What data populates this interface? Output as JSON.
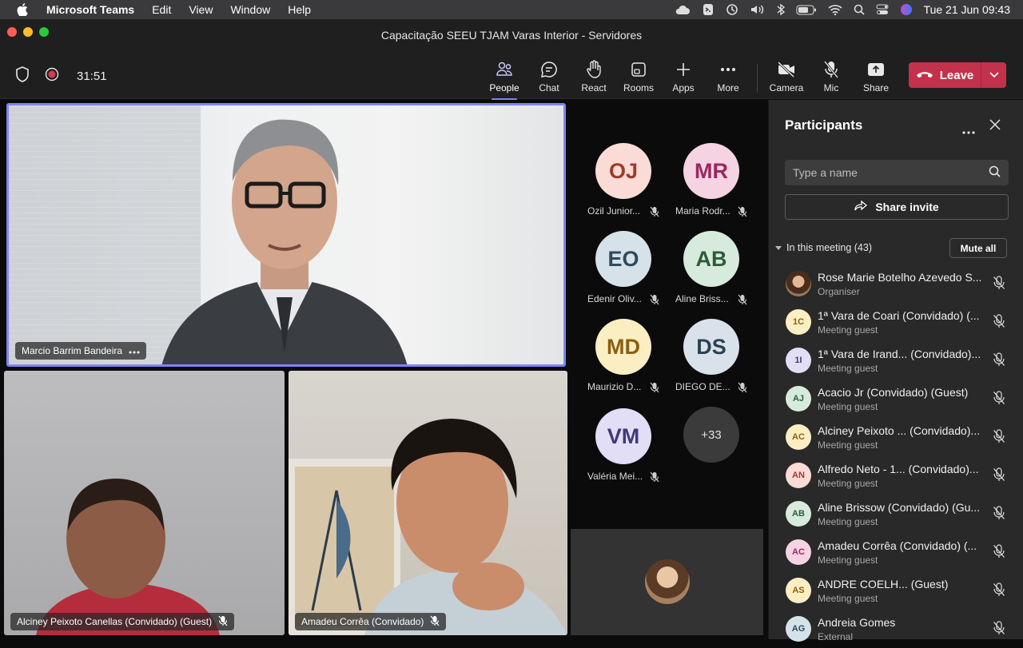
{
  "menubar": {
    "app": "Microsoft Teams",
    "items": [
      "Edit",
      "View",
      "Window",
      "Help"
    ],
    "clock": "Tue 21 Jun  09:43"
  },
  "window": {
    "title": "Capacitação SEEU TJAM Varas Interior - Servidores"
  },
  "toolbar": {
    "timer": "31:51",
    "buttons": [
      {
        "label": "People",
        "icon": "people-icon"
      },
      {
        "label": "Chat",
        "icon": "chat-icon"
      },
      {
        "label": "React",
        "icon": "hand-icon"
      },
      {
        "label": "Rooms",
        "icon": "rooms-icon"
      },
      {
        "label": "Apps",
        "icon": "plus-icon"
      },
      {
        "label": "More",
        "icon": "more-icon"
      },
      {
        "label": "Camera",
        "icon": "camera-off-icon"
      },
      {
        "label": "Mic",
        "icon": "mic-off-icon"
      },
      {
        "label": "Share",
        "icon": "share-icon"
      }
    ],
    "leave_label": "Leave"
  },
  "stage": {
    "main_video": "Marcio Barrim Bandeira",
    "bottom_left": "Alciney Peixoto Canellas (Convidado) (Guest)",
    "bottom_right": "Amadeu Corrêa (Convidado)",
    "tiles": [
      {
        "initials": "OJ",
        "name": "Ozil Junior...",
        "bg": "#fadbd5",
        "fg": "#9e3a2a"
      },
      {
        "initials": "MR",
        "name": "Maria Rodr...",
        "bg": "#f6d3e3",
        "fg": "#9b2760"
      },
      {
        "initials": "EO",
        "name": "Edenir Oliv...",
        "bg": "#d6e2ea",
        "fg": "#2d4b5f"
      },
      {
        "initials": "AB",
        "name": "Aline Briss...",
        "bg": "#d7ebdc",
        "fg": "#2e5c3a"
      },
      {
        "initials": "MD",
        "name": "Maurizio D...",
        "bg": "#fbeec3",
        "fg": "#8a5f10"
      },
      {
        "initials": "DS",
        "name": "DIEGO DE...",
        "bg": "#d9e2ea",
        "fg": "#2b4252"
      },
      {
        "initials": "VM",
        "name": "Valéria Mei...",
        "bg": "#e1def6",
        "fg": "#3f3a7a"
      }
    ],
    "more_count": "+33"
  },
  "panel": {
    "title": "Participants",
    "search_placeholder": "Type a name",
    "share_invite": "Share invite",
    "in_meeting": "In this meeting (43)",
    "mute_all": "Mute all",
    "participants": [
      {
        "initials": "",
        "name": "Rose Marie Botelho Azevedo S...",
        "role": "Organiser",
        "bg": "#a07a5a",
        "fg": "#fff"
      },
      {
        "initials": "1C",
        "name": "1ª Vara de Coari (Convidado) (...",
        "role": "Meeting guest",
        "bg": "#fbeec3",
        "fg": "#8a5f10"
      },
      {
        "initials": "1I",
        "name": "1ª Vara de Irand... (Convidado)...",
        "role": "Meeting guest",
        "bg": "#e1def6",
        "fg": "#3f3a7a"
      },
      {
        "initials": "AJ",
        "name": "Acacio Jr (Convidado) (Guest)",
        "role": "Meeting guest",
        "bg": "#d7ebdc",
        "fg": "#2e5c3a"
      },
      {
        "initials": "AC",
        "name": "Alciney Peixoto ... (Convidado)...",
        "role": "Meeting guest",
        "bg": "#fbeec3",
        "fg": "#8a5f10"
      },
      {
        "initials": "AN",
        "name": "Alfredo Neto - 1... (Convidado)...",
        "role": "Meeting guest",
        "bg": "#fadbd5",
        "fg": "#9e3a2a"
      },
      {
        "initials": "AB",
        "name": "Aline Brissow (Convidado) (Gu...",
        "role": "Meeting guest",
        "bg": "#d7ebdc",
        "fg": "#2e5c3a"
      },
      {
        "initials": "AC",
        "name": "Amadeu Corrêa (Convidado) (...",
        "role": "Meeting guest",
        "bg": "#f6d3e3",
        "fg": "#9b2760"
      },
      {
        "initials": "AS",
        "name": "ANDRE COELH... (Guest)",
        "role": "Meeting guest",
        "bg": "#fbeec3",
        "fg": "#8a5f10"
      },
      {
        "initials": "AG",
        "name": "Andreia Gomes",
        "role": "External",
        "bg": "#d6e2ea",
        "fg": "#2d4b5f"
      }
    ]
  },
  "colors": {
    "accent": "#7f85f5",
    "leave": "#c4314b"
  }
}
